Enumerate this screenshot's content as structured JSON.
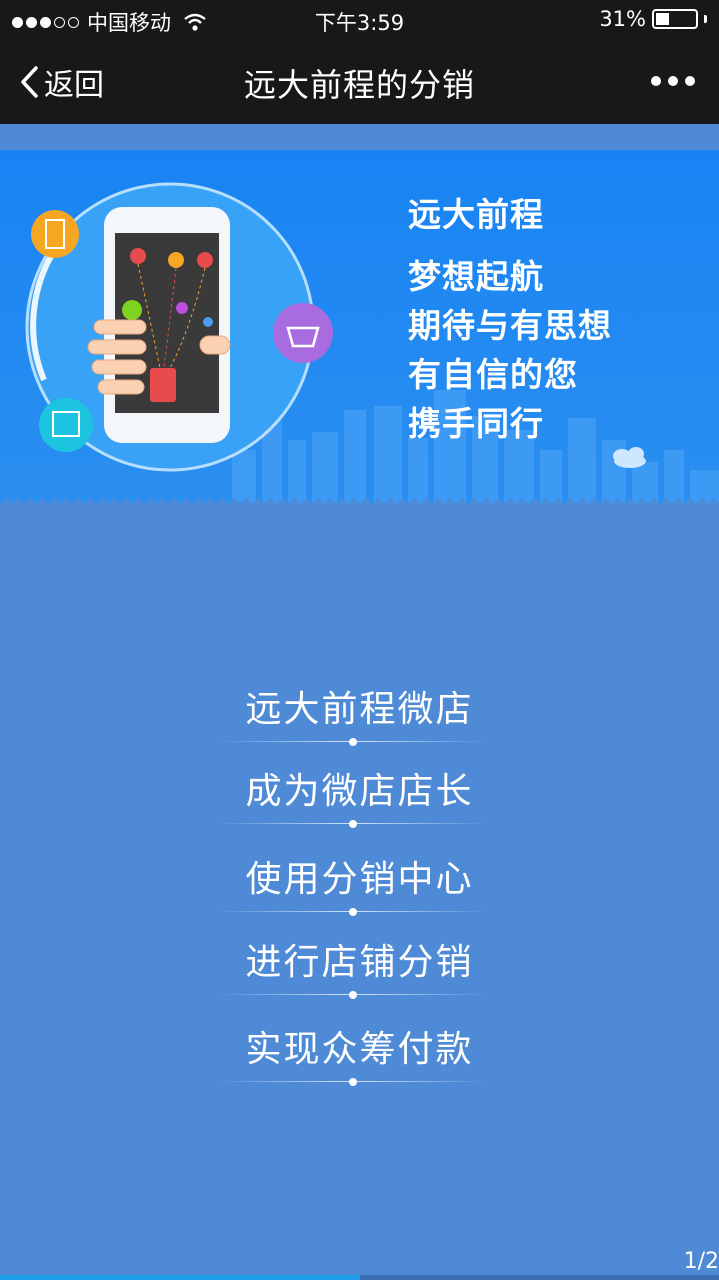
{
  "status_bar": {
    "carrier": "中国移动",
    "time": "下午3:59",
    "battery": "31%",
    "battery_level": 0.31
  },
  "nav": {
    "back_label": "返回",
    "title": "远大前程的分销",
    "more_icon": "ellipsis-icon"
  },
  "banner": {
    "headline": "远大前程",
    "lines": [
      "梦想起航",
      "期待与有思想",
      "有自信的您",
      "携手同行"
    ],
    "accent": "#1883f3"
  },
  "menu": {
    "items": [
      {
        "label": "远大前程微店"
      },
      {
        "label": "成为微店店长"
      },
      {
        "label": "使用分销中心"
      },
      {
        "label": "进行店铺分销"
      },
      {
        "label": "实现众筹付款"
      }
    ]
  },
  "pager": {
    "text": "1/2",
    "progress": 0.5
  },
  "colors": {
    "page_bg": "#4e8ad6",
    "bar_bg": "#18181a"
  }
}
